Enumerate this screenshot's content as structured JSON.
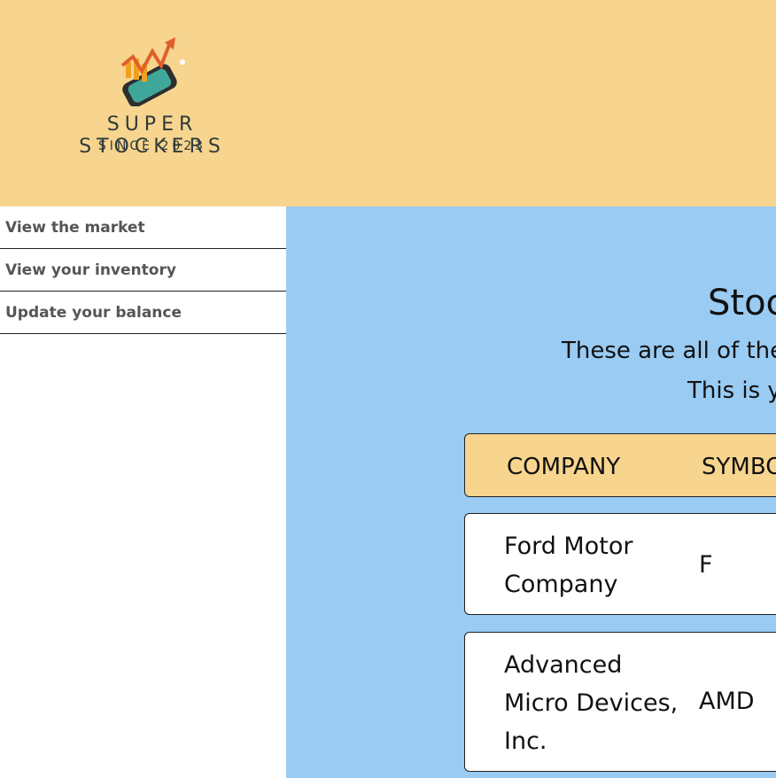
{
  "header": {
    "brand": "SUPER STOCKERS",
    "since": "SINCE 2023",
    "background": "#f7d58f"
  },
  "sidebar": {
    "items": [
      {
        "label": "View the market"
      },
      {
        "label": "View your inventory"
      },
      {
        "label": "Update your balance"
      }
    ]
  },
  "main": {
    "background": "#99cbf3",
    "title": "Stoc",
    "subtitle": "These are all of the",
    "balance_line": "This is y",
    "table": {
      "headers": [
        "COMPANY",
        "SYMBO"
      ],
      "rows": [
        {
          "company": "Ford Motor Company",
          "symbol": "F"
        },
        {
          "company": "Advanced Micro Devices, Inc.",
          "symbol": "AMD"
        }
      ]
    }
  }
}
